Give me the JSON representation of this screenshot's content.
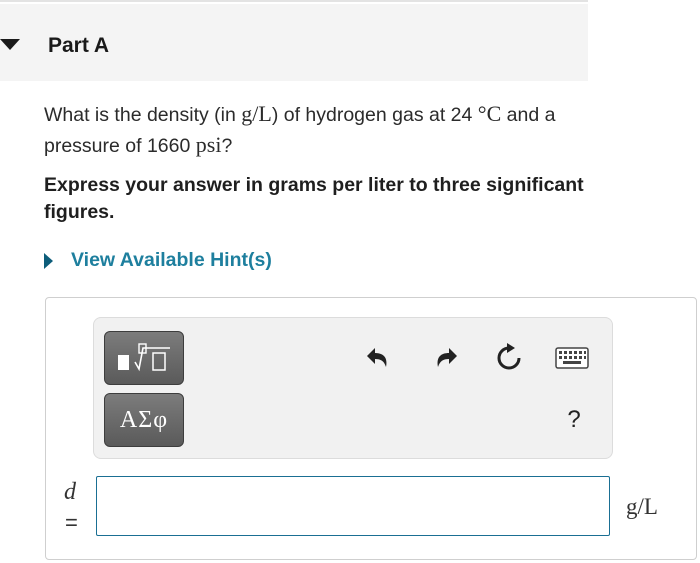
{
  "part": {
    "title": "Part A"
  },
  "question": {
    "text_1": "What is the density (in ",
    "unit_density": "g/L",
    "text_2": ") of hydrogen gas at 24 ",
    "temp_unit": "°C",
    "text_3": " and a pressure of 1660 ",
    "pressure_unit": "psi",
    "text_4": "?"
  },
  "instructions": "Express your answer in grams per liter to three significant figures.",
  "hint": {
    "label": "View Available Hint(s)"
  },
  "toolbar": {
    "symbols_label": "ΑΣφ",
    "help_label": "?",
    "icons": [
      "templates-icon",
      "undo-icon",
      "redo-icon",
      "reset-icon",
      "keyboard-icon"
    ]
  },
  "answer": {
    "variable": "d",
    "equals": "=",
    "value": "",
    "unit": "g/L"
  },
  "colors": {
    "hint_link": "#1e7f9e",
    "input_border": "#1a6f93",
    "header_bg": "#f4f4f4"
  }
}
